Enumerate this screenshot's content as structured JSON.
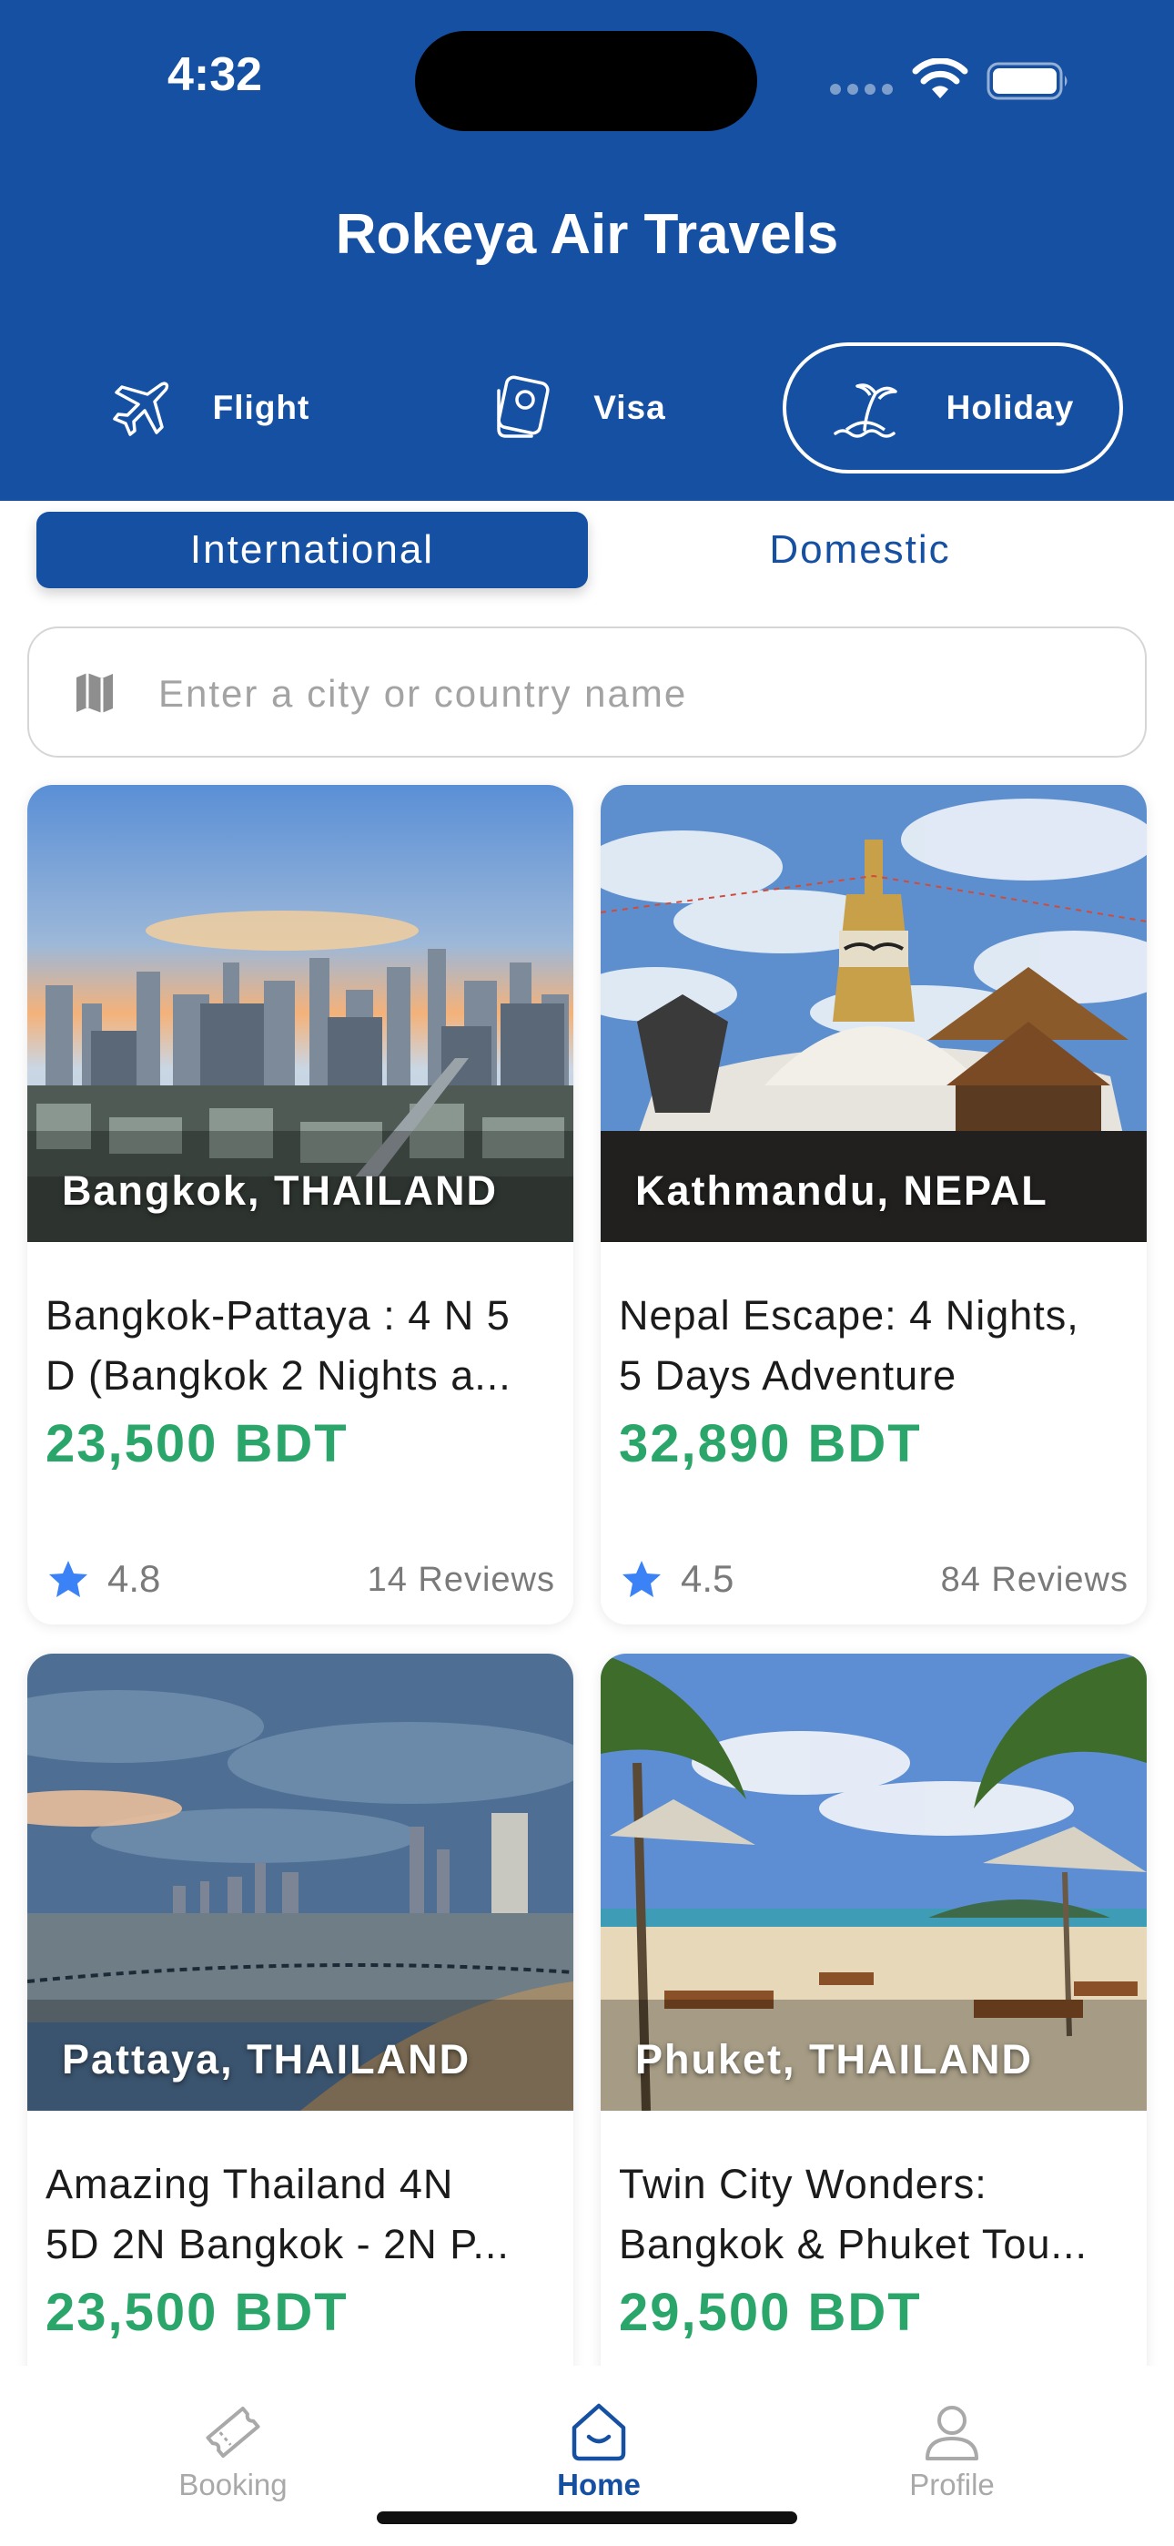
{
  "status_bar": {
    "time": "4:32"
  },
  "app": {
    "title": "Rokeya Air Travels"
  },
  "service_tabs": [
    {
      "label": "Flight",
      "icon": "airplane-icon",
      "active": false
    },
    {
      "label": "Visa",
      "icon": "passport-icon",
      "active": false
    },
    {
      "label": "Holiday",
      "icon": "island-palm-icon",
      "active": true
    }
  ],
  "segment": {
    "international": "International",
    "domestic": "Domestic",
    "selected": "International"
  },
  "search": {
    "placeholder": "Enter a city or country name",
    "value": "",
    "icon": "map-icon"
  },
  "cards": [
    {
      "location": "Bangkok, THAILAND",
      "line1": "Bangkok-Pattaya : 4 N 5",
      "line2": "D  (Bangkok 2 Nights a...",
      "price": "23,500 BDT",
      "rating": "4.8",
      "reviews": "14 Reviews"
    },
    {
      "location": "Kathmandu, NEPAL",
      "line1": "Nepal Escape: 4 Nights,",
      "line2": "5 Days Adventure",
      "price": "32,890 BDT",
      "rating": "4.5",
      "reviews": "84 Reviews"
    },
    {
      "location": "Pattaya, THAILAND",
      "line1": "Amazing Thailand 4N",
      "line2": "5D  2N Bangkok - 2N P...",
      "price": "23,500 BDT"
    },
    {
      "location": "Phuket, THAILAND",
      "line1": "Twin City Wonders:",
      "line2": "Bangkok & Phuket Tou...",
      "price": "29,500 BDT"
    }
  ],
  "bottom_nav": [
    {
      "label": "Booking",
      "icon": "ticket-icon",
      "active": false
    },
    {
      "label": "Home",
      "icon": "home-icon",
      "active": true
    },
    {
      "label": "Profile",
      "icon": "profile-icon",
      "active": false
    }
  ],
  "colors": {
    "primary": "#1550A3",
    "price": "#2BA66A",
    "star": "#3B82F6"
  }
}
